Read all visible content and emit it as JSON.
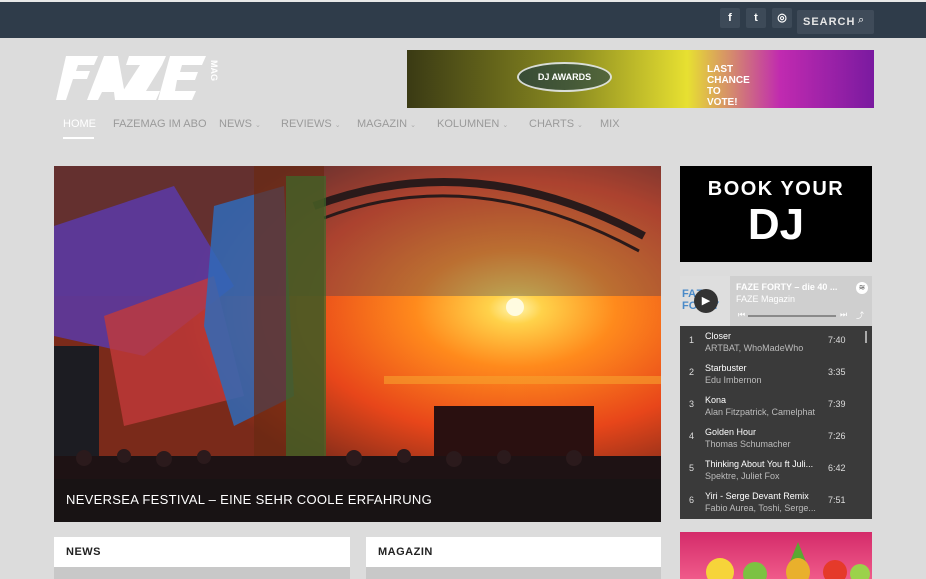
{
  "topbar": {
    "social": [
      {
        "icon": "facebook-icon",
        "glyph": "f"
      },
      {
        "icon": "twitter-icon",
        "glyph": "t"
      },
      {
        "icon": "instagram-icon",
        "glyph": "◎"
      }
    ],
    "search_placeholder": "SEARCH"
  },
  "logo": {
    "text": "FAZE",
    "sub": "MAG"
  },
  "banner": {
    "dj_awards": "DJ AWARDS",
    "last_chance": "LAST CHANCE TO VOTE!"
  },
  "nav": {
    "items": [
      {
        "label": "HOME",
        "active": true,
        "dropdown": false
      },
      {
        "label": "FAZEMAG IM ABO",
        "active": false,
        "dropdown": false
      },
      {
        "label": "NEWS",
        "active": false,
        "dropdown": true
      },
      {
        "label": "REVIEWS",
        "active": false,
        "dropdown": true
      },
      {
        "label": "MAGAZIN",
        "active": false,
        "dropdown": true
      },
      {
        "label": "KOLUMNEN",
        "active": false,
        "dropdown": true
      },
      {
        "label": "CHARTS",
        "active": false,
        "dropdown": true
      },
      {
        "label": "MIX",
        "active": false,
        "dropdown": false
      }
    ]
  },
  "hero": {
    "caption": "NEVERSEA FESTIVAL – EINE SEHR COOLE ERFAHRUNG"
  },
  "sidebar": {
    "book_dj": {
      "line1": "BOOK YOUR",
      "line2": "DJ"
    },
    "player": {
      "art_text": "FAZE FORTY",
      "title": "FAZE FORTY – die 40 ...",
      "subtitle": "FAZE Magazin",
      "tracks": [
        {
          "num": "1",
          "title": "Closer",
          "artist": "ARTBAT, WhoMadeWho",
          "duration": "7:40"
        },
        {
          "num": "2",
          "title": "Starbuster",
          "artist": "Edu Imbernon",
          "duration": "3:35"
        },
        {
          "num": "3",
          "title": "Kona",
          "artist": "Alan Fitzpatrick, Camelphat",
          "duration": "7:39"
        },
        {
          "num": "4",
          "title": "Golden Hour",
          "artist": "Thomas Schumacher",
          "duration": "7:26"
        },
        {
          "num": "5",
          "title": "Thinking About You ft Juli...",
          "artist": "Spektre, Juliet Fox",
          "duration": "6:42"
        },
        {
          "num": "6",
          "title": "Yiri - Serge Devant Remix",
          "artist": "Fabio Aurea, Toshi, Serge...",
          "duration": "7:51"
        }
      ]
    }
  },
  "sections": {
    "news": "NEWS",
    "magazin": "MAGAZIN"
  }
}
